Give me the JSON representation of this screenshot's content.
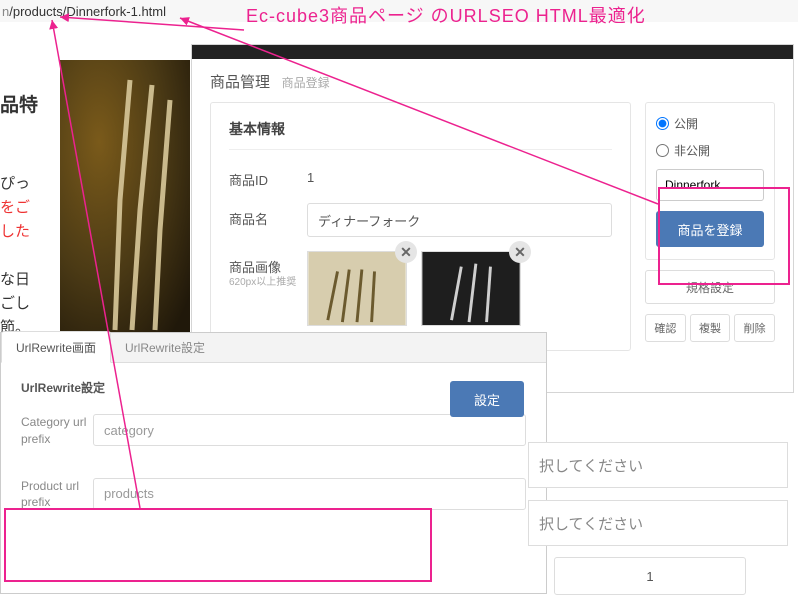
{
  "url": {
    "prefix": "n",
    "path": "/products/Dinnerfork-1.html"
  },
  "annotation_title": "Ec-cube3商品ページ のURLSEO HTML最適化",
  "background_text": {
    "heading": "品特",
    "lines": [
      "ぴっ",
      "をご",
      "した",
      "",
      "な日",
      "ごし",
      "節。"
    ]
  },
  "admin": {
    "breadcrumb": {
      "level1": "商品管理",
      "level2": "商品登録"
    },
    "section_title": "基本情報",
    "product_id": {
      "label": "商品ID",
      "value": "1"
    },
    "product_name": {
      "label": "商品名",
      "value": "ディナーフォーク"
    },
    "product_image": {
      "label": "商品画像",
      "sub": "620px以上推奨"
    },
    "side": {
      "public_label": "公開",
      "private_label": "非公開",
      "public_value": "public",
      "url_field_value": "Dinnerfork",
      "register_button": "商品を登録",
      "spec_button": "規格設定",
      "confirm_button": "確認",
      "duplicate_button": "複製",
      "delete_button": "削除"
    }
  },
  "rewrite": {
    "tab1": "UrlRewrite画面",
    "tab2": "UrlRewrite設定",
    "heading": "UrlRewrite設定",
    "category": {
      "label": "Category url prefix",
      "value": "category"
    },
    "product": {
      "label": "Product url prefix",
      "value": "products"
    },
    "button": "設定"
  },
  "partial": {
    "placeholder": "択してください",
    "number": "1"
  }
}
